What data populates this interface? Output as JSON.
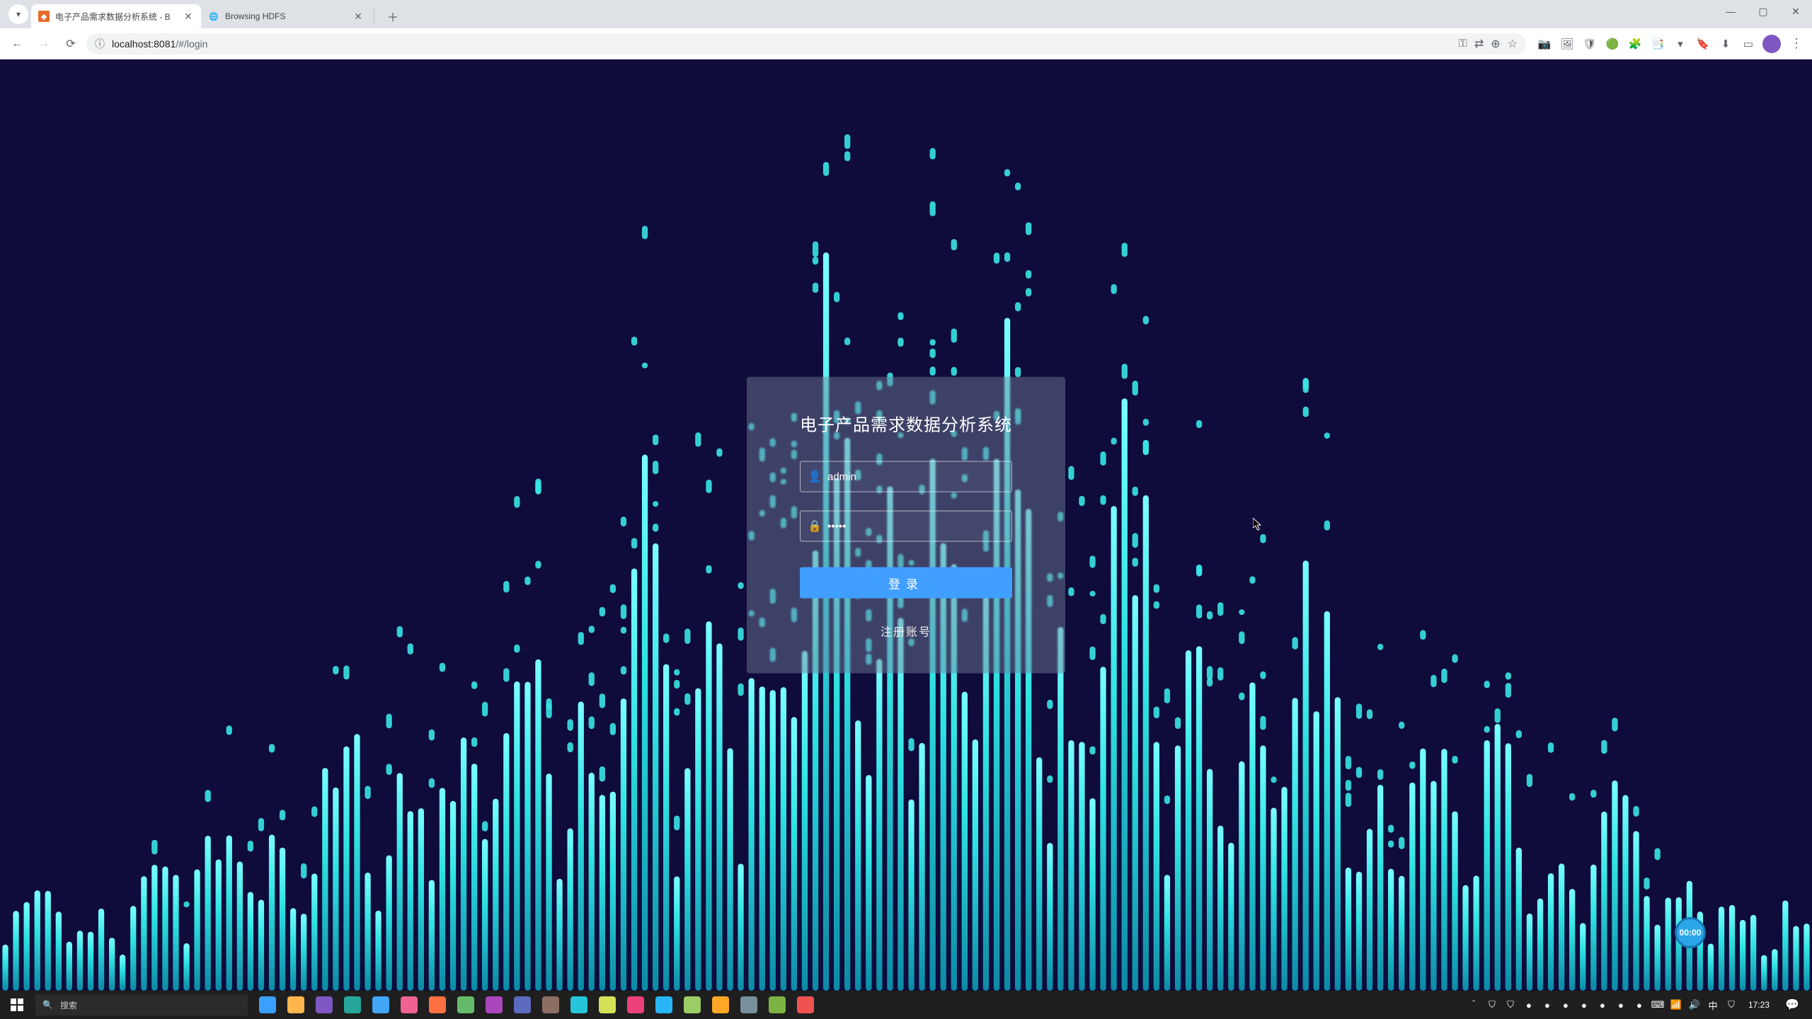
{
  "browser": {
    "tabs": [
      {
        "title": "电子产品需求数据分析系统 - B",
        "favicon_color": "#e86a2a",
        "active": true
      },
      {
        "title": "Browsing HDFS",
        "favicon_color": "#6aa84f",
        "active": false
      }
    ],
    "window_controls": {
      "minimize": "—",
      "maximize": "▢",
      "close": "✕"
    },
    "nav": {
      "back": "←",
      "forward": "→",
      "reload": "⟳"
    },
    "address": {
      "secure_icon": "ⓘ",
      "host": "localhost:8081",
      "path": "/#/login"
    },
    "addr_actions": {
      "pw": "⚿",
      "translate": "⇄",
      "zoom": "⊕",
      "star": "☆"
    },
    "extensions": [
      "📷",
      "🖼",
      "🛡",
      "🟢",
      "🧩",
      "📑",
      "▾",
      "🔖",
      "⬇",
      "▭",
      "👤"
    ]
  },
  "page": {
    "title": "电子产品需求数据分析系统",
    "form": {
      "username_value": "admin",
      "password_value": "•••••",
      "login_button": "登录",
      "register_link": "注册账号"
    },
    "badge_text": "00:00"
  },
  "taskbar": {
    "search_placeholder": "搜索",
    "app_colors": [
      "#3aa0ff",
      "#ffb74d",
      "#7e57c2",
      "#26a69a",
      "#42a5f5",
      "#f06292",
      "#ff7043",
      "#66bb6a",
      "#ab47bc",
      "#5c6bc0",
      "#8d6e63",
      "#26c6da",
      "#d4e157",
      "#ec407a",
      "#29b6f6",
      "#9ccc65",
      "#ffa726",
      "#78909c",
      "#7cb342",
      "#ef5350"
    ],
    "tray_icons": [
      "＾",
      "⛉",
      "⛉",
      "●",
      "●",
      "●",
      "●",
      "●",
      "●",
      "●",
      "⌨",
      "📶",
      "🔊",
      "中",
      "⛉"
    ],
    "time": "17:23",
    "date": "",
    "notif": "💬"
  }
}
